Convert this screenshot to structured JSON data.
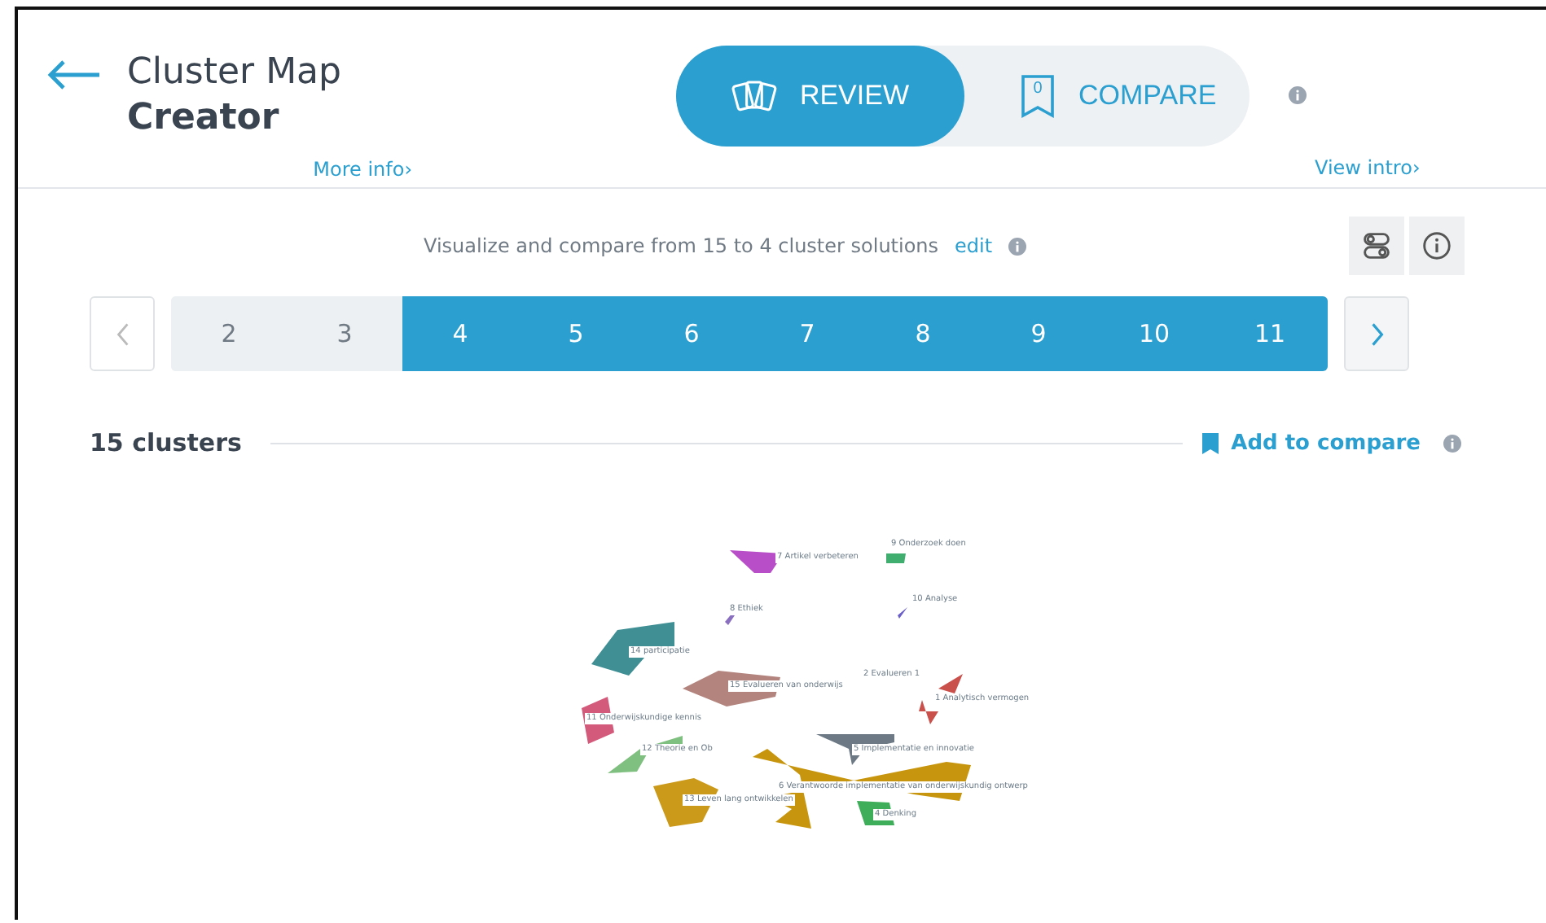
{
  "header": {
    "title": "Cluster Map",
    "subtitle": "Creator",
    "more_info": "More info›",
    "view_intro": "View intro›"
  },
  "mode_tabs": [
    {
      "label": "REVIEW",
      "kind": "cards",
      "selected": true
    },
    {
      "label": "COMPARE",
      "kind": "bookmark",
      "badge": "0",
      "selected": false
    }
  ],
  "solutions": {
    "description": "Visualize and compare from 15 to 4 cluster solutions",
    "edit": "edit",
    "items": [
      {
        "label": "2",
        "selected": false
      },
      {
        "label": "3",
        "selected": false
      },
      {
        "label": "4",
        "selected": true
      },
      {
        "label": "5",
        "selected": true
      },
      {
        "label": "6",
        "selected": true
      },
      {
        "label": "7",
        "selected": true
      },
      {
        "label": "8",
        "selected": true
      },
      {
        "label": "9",
        "selected": true
      },
      {
        "label": "10",
        "selected": true
      },
      {
        "label": "11",
        "selected": true
      }
    ]
  },
  "map": {
    "title": "15 clusters",
    "add_to_compare": "Add to compare",
    "clusters": [
      {
        "label": "7 Artikel verbeteren",
        "color": "#b84fc8"
      },
      {
        "label": "9 Onderzoek doen",
        "color": "#3fae6e"
      },
      {
        "label": "8 Ethiek",
        "color": "#8a6fc0"
      },
      {
        "label": "10 Analyse",
        "color": "#6a5fc8"
      },
      {
        "label": "14 participatie",
        "color": "#3f8f94"
      },
      {
        "label": "15 Evalueren van onderwijs",
        "color": "#b3847e"
      },
      {
        "label": "2 Evalueren 1",
        "color": "#c9504b"
      },
      {
        "label": "1 Analytisch vermogen",
        "color": "#c9504b"
      },
      {
        "label": "11 Onderwijskundige kennis",
        "color": "#d45a7c"
      },
      {
        "label": "12 Theorie en Ob",
        "color": "#7fbf7f"
      },
      {
        "label": "5 Implementatie en innovatie",
        "color": "#6d7a86"
      },
      {
        "label": "13 Leven lang ontwikkelen",
        "color": "#cc9a1a"
      },
      {
        "label": "6 Verantwoorde implementatie van onderwijskundig ontwerp",
        "color": "#c8960e"
      },
      {
        "label": "4 Denking",
        "color": "#3fae5a"
      }
    ]
  }
}
